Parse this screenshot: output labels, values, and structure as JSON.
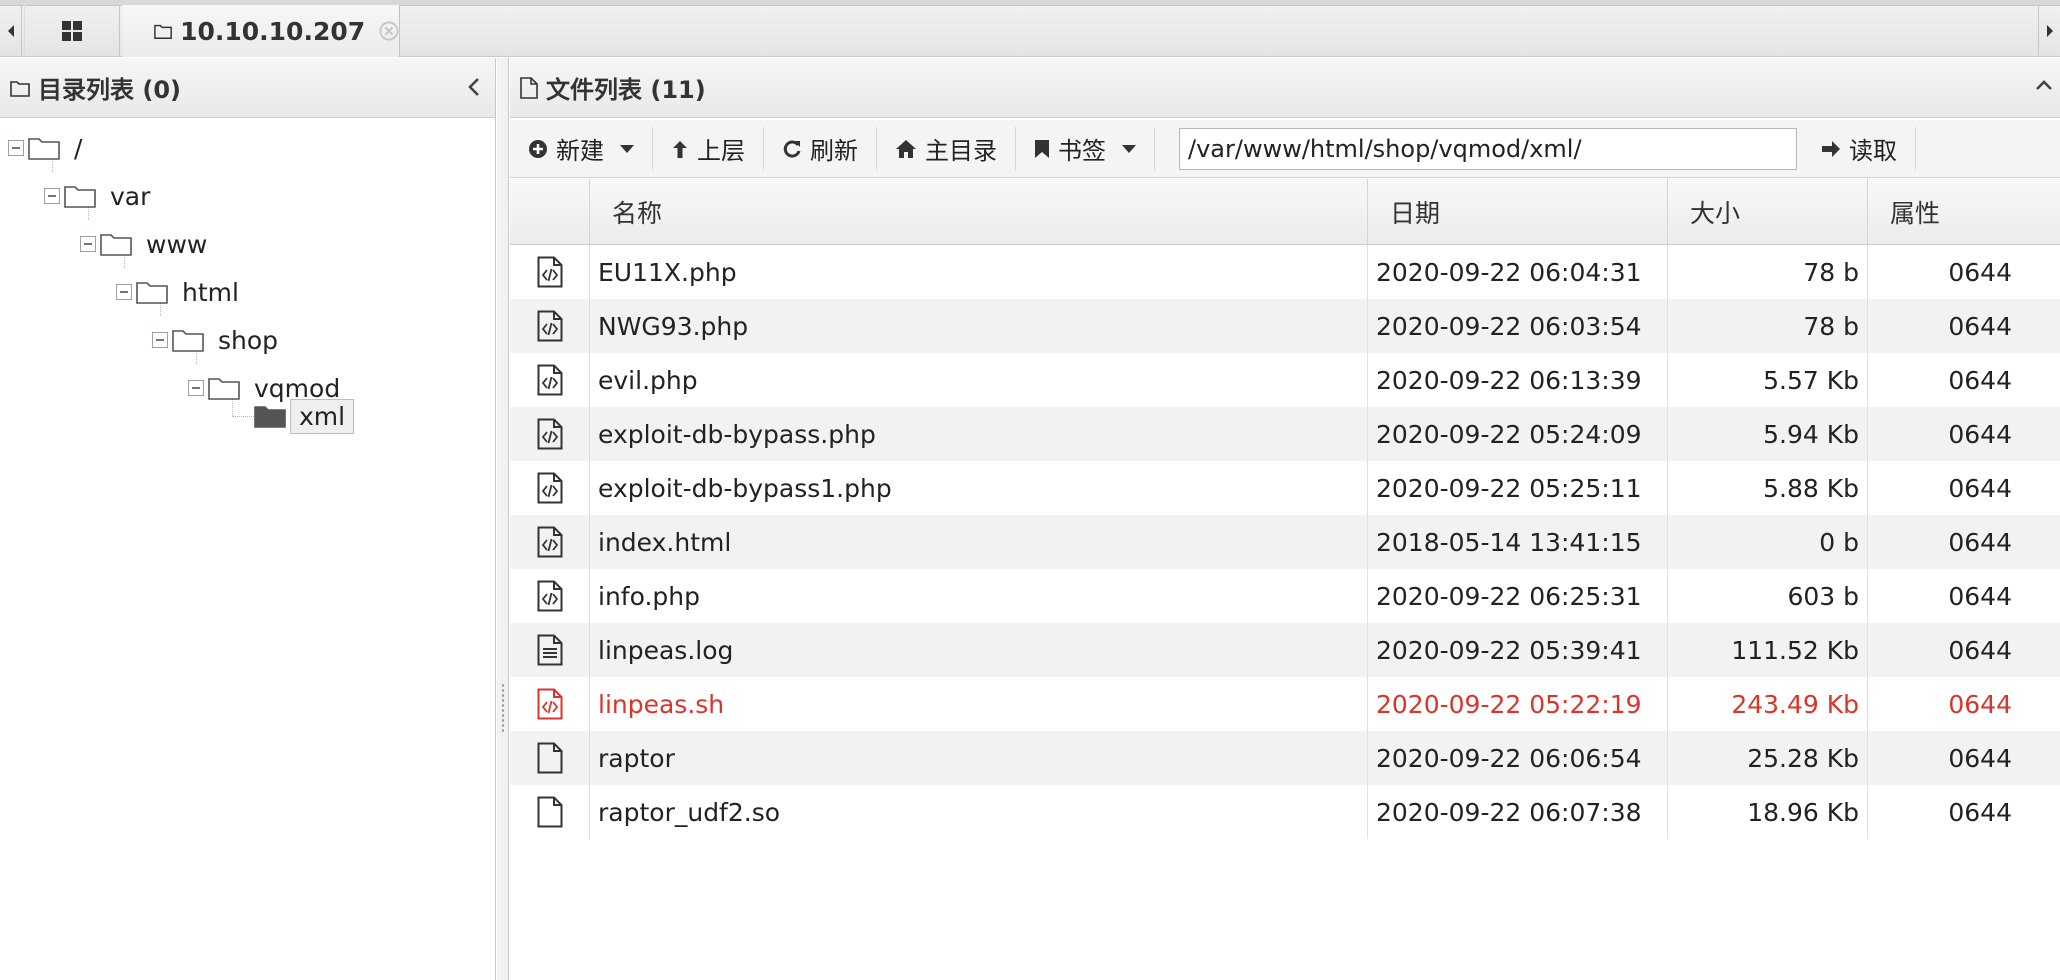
{
  "tabs": {
    "host_label": "10.10.10.207"
  },
  "left_panel": {
    "title": "目录列表 (0)",
    "tree": [
      {
        "label": "/"
      },
      {
        "label": "var"
      },
      {
        "label": "www"
      },
      {
        "label": "html"
      },
      {
        "label": "shop"
      },
      {
        "label": "vqmod"
      },
      {
        "label": "xml"
      }
    ]
  },
  "right_panel": {
    "title": "文件列表 (11)",
    "toolbar": {
      "new_label": "新建",
      "up_label": "上层",
      "refresh_label": "刷新",
      "home_label": "主目录",
      "bookmark_label": "书签",
      "path_value": "/var/www/html/shop/vqmod/xml/",
      "read_label": "读取"
    },
    "columns": {
      "name": "名称",
      "date": "日期",
      "size": "大小",
      "attr": "属性"
    },
    "files": [
      {
        "icon": "code-file-icon",
        "name": "EU11X.php",
        "date": "2020-09-22 06:04:31",
        "size": "78 b",
        "attr": "0644"
      },
      {
        "icon": "code-file-icon",
        "name": "NWG93.php",
        "date": "2020-09-22 06:03:54",
        "size": "78 b",
        "attr": "0644"
      },
      {
        "icon": "code-file-icon",
        "name": "evil.php",
        "date": "2020-09-22 06:13:39",
        "size": "5.57 Kb",
        "attr": "0644"
      },
      {
        "icon": "code-file-icon",
        "name": "exploit-db-bypass.php",
        "date": "2020-09-22 05:24:09",
        "size": "5.94 Kb",
        "attr": "0644"
      },
      {
        "icon": "code-file-icon",
        "name": "exploit-db-bypass1.php",
        "date": "2020-09-22 05:25:11",
        "size": "5.88 Kb",
        "attr": "0644"
      },
      {
        "icon": "code-file-icon",
        "name": "index.html",
        "date": "2018-05-14 13:41:15",
        "size": "0 b",
        "attr": "0644"
      },
      {
        "icon": "code-file-icon",
        "name": "info.php",
        "date": "2020-09-22 06:25:31",
        "size": "603 b",
        "attr": "0644"
      },
      {
        "icon": "text-file-icon",
        "name": "linpeas.log",
        "date": "2020-09-22 05:39:41",
        "size": "111.52 Kb",
        "attr": "0644"
      },
      {
        "icon": "code-file-icon",
        "name": "linpeas.sh",
        "date": "2020-09-22 05:22:19",
        "size": "243.49 Kb",
        "attr": "0644",
        "highlight": true
      },
      {
        "icon": "blank-file-icon",
        "name": "raptor",
        "date": "2020-09-22 06:06:54",
        "size": "25.28 Kb",
        "attr": "0644"
      },
      {
        "icon": "blank-file-icon",
        "name": "raptor_udf2.so",
        "date": "2020-09-22 06:07:38",
        "size": "18.96 Kb",
        "attr": "0644"
      }
    ]
  },
  "colors": {
    "highlight_text": "#d9352b",
    "selected_folder": "#555555"
  }
}
